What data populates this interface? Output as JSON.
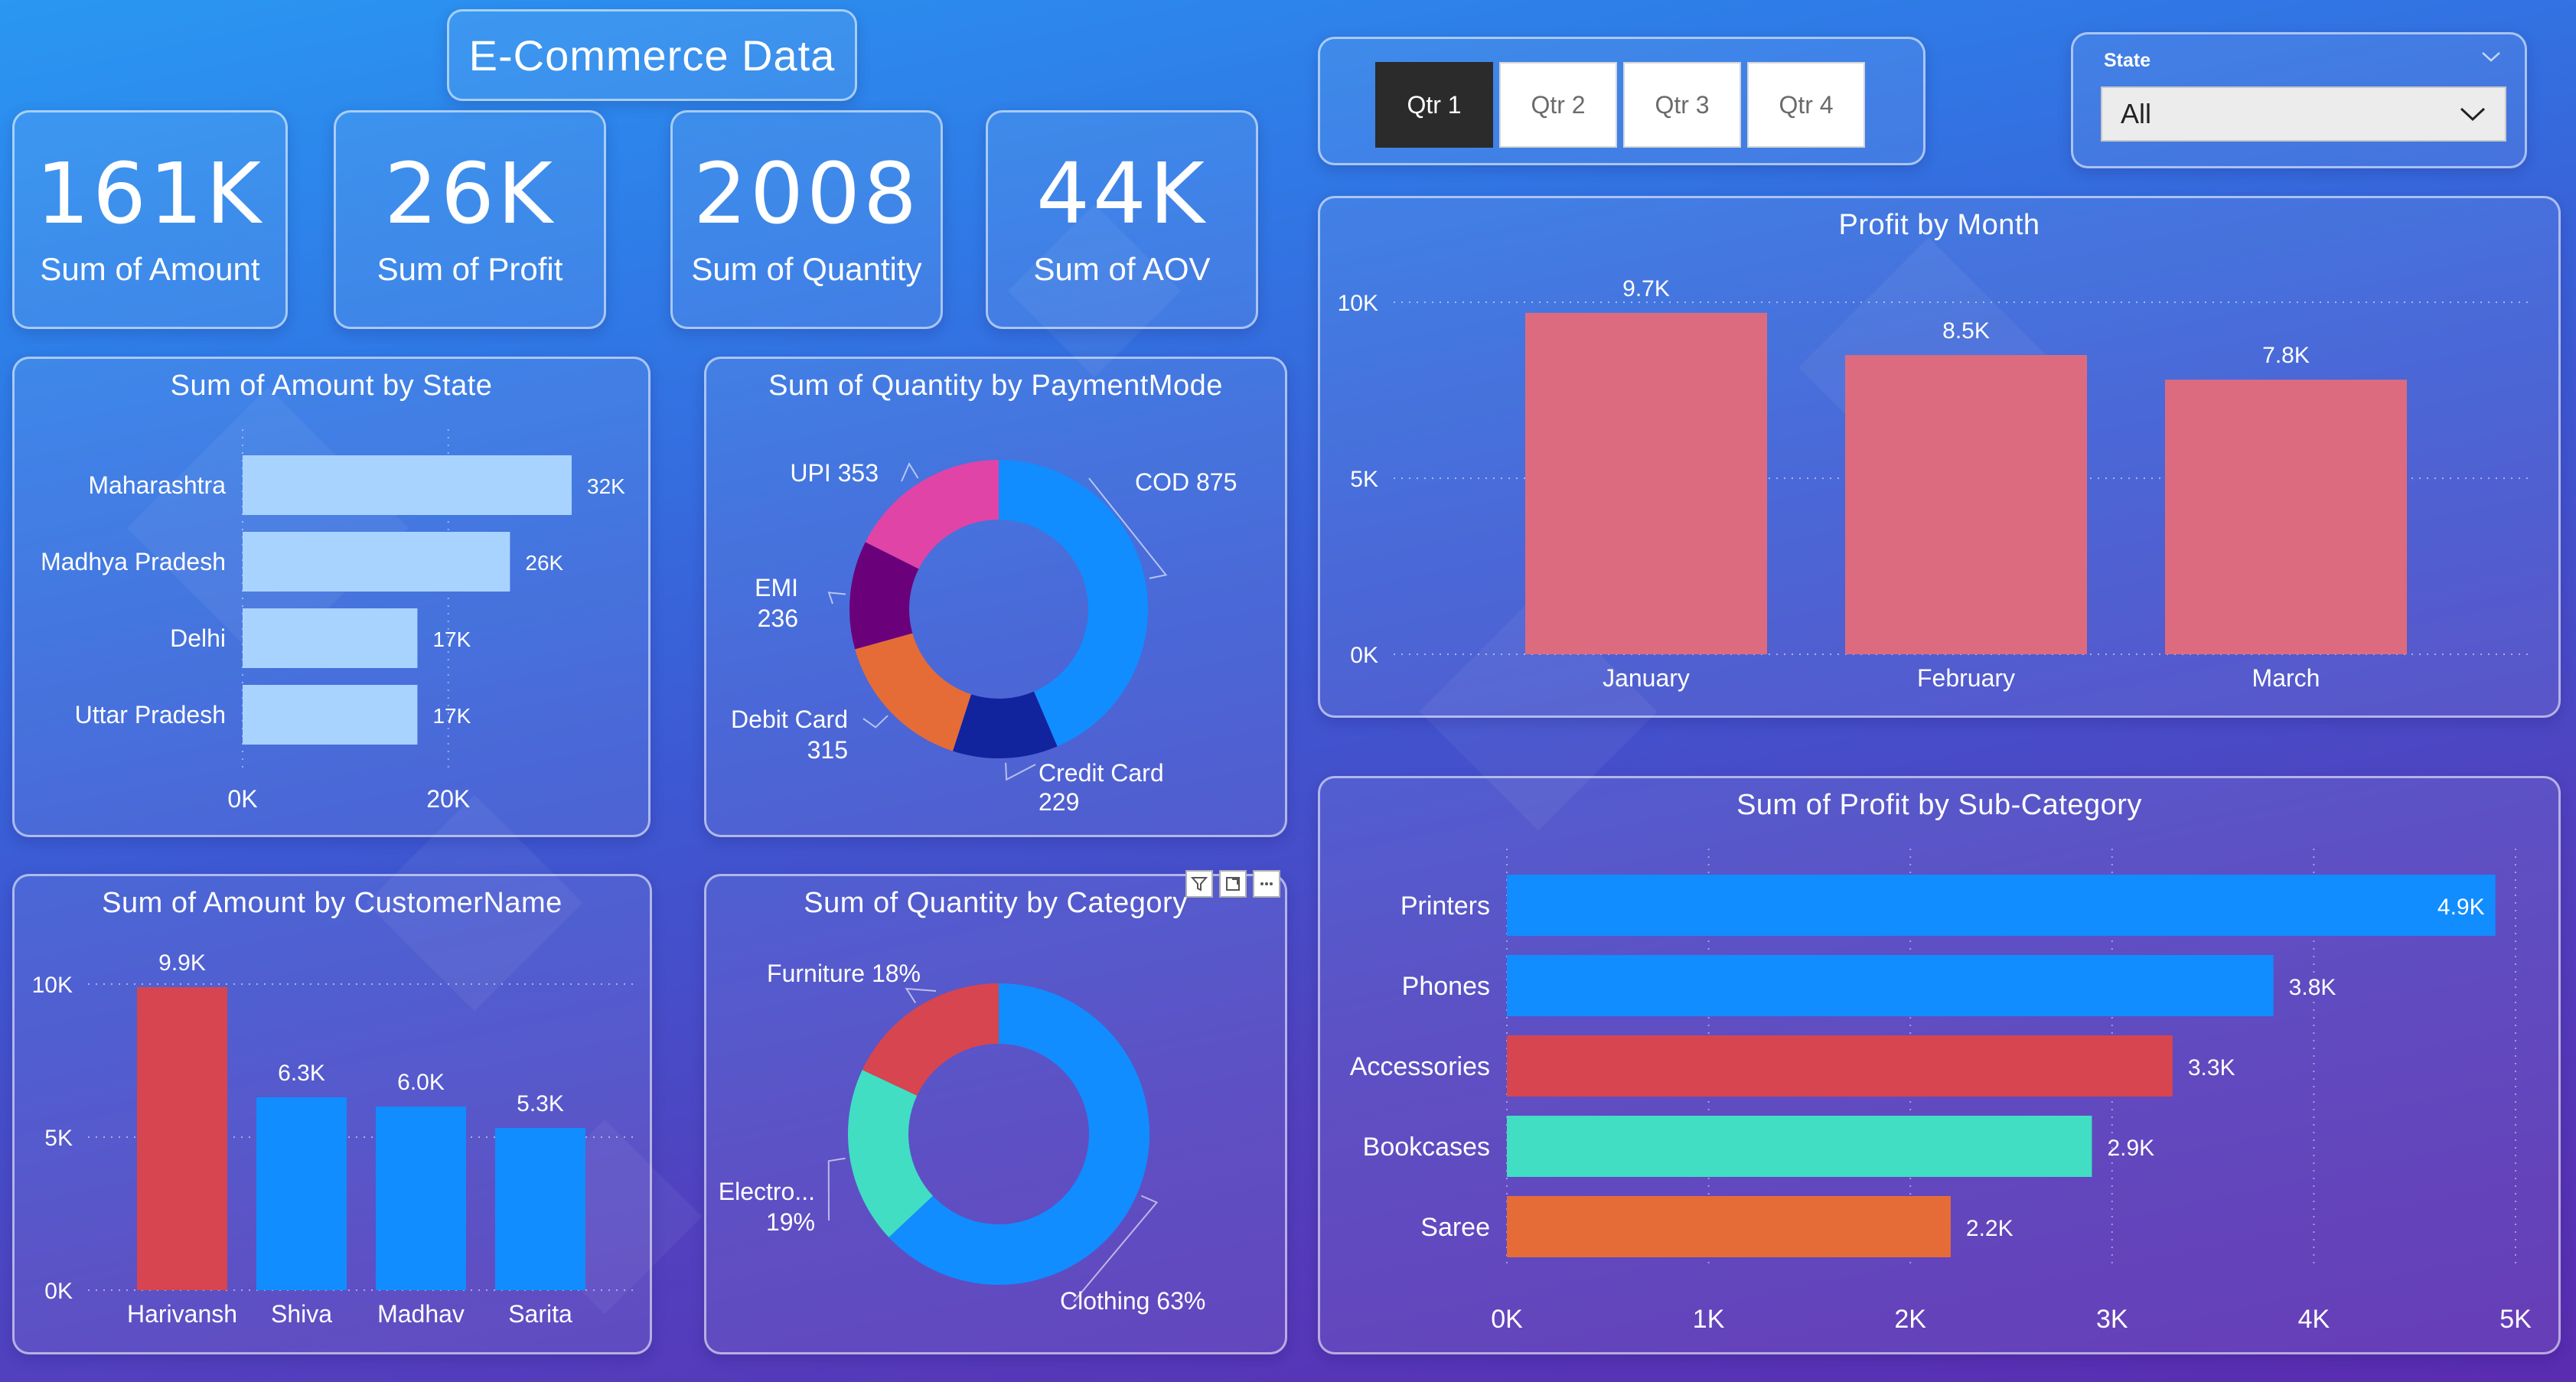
{
  "dashboard_title": "E-Commerce Data",
  "kpis": [
    {
      "value": "161K",
      "label": "Sum of Amount"
    },
    {
      "value": "26K",
      "label": "Sum of Profit"
    },
    {
      "value": "2008",
      "label": "Sum of Quantity"
    },
    {
      "value": "44K",
      "label": "Sum of AOV"
    }
  ],
  "quarter_slicer": {
    "buttons": [
      "Qtr 1",
      "Qtr 2",
      "Qtr 3",
      "Qtr 4"
    ],
    "selected": "Qtr 1"
  },
  "state_slicer": {
    "label": "State",
    "value": "All"
  },
  "colors": {
    "light_bar": "#a9d3ff",
    "blue": "#118dff",
    "salmon": "#dd6b7f",
    "red": "#d64550",
    "teal": "#41dec4",
    "orange": "#e66c37",
    "pink": "#e044a7",
    "purple": "#6b007b",
    "navy": "#12239e",
    "dark_slicer": "#2b2b2b"
  },
  "chart_data": [
    {
      "id": "amount_by_state",
      "type": "bar",
      "orientation": "horizontal",
      "title": "Sum of Amount by State",
      "categories": [
        "Maharashtra",
        "Madhya Pradesh",
        "Delhi",
        "Uttar Pradesh"
      ],
      "values": [
        32000,
        26000,
        17000,
        17000
      ],
      "data_labels": [
        "32K",
        "26K",
        "17K",
        "17K"
      ],
      "xticks": [
        "0K",
        "20K"
      ],
      "xlim": [
        0,
        32000
      ],
      "grid": true
    },
    {
      "id": "quantity_by_paymentmode",
      "type": "pie",
      "donut": true,
      "title": "Sum of Quantity by PaymentMode",
      "categories": [
        "COD",
        "Credit Card",
        "Debit Card",
        "EMI",
        "UPI"
      ],
      "values": [
        875,
        229,
        315,
        236,
        353
      ],
      "colors": [
        "#118dff",
        "#12239e",
        "#e66c37",
        "#6b007b",
        "#e044a7"
      ]
    },
    {
      "id": "profit_by_month",
      "type": "bar",
      "orientation": "vertical",
      "title": "Profit by Month",
      "categories": [
        "January",
        "February",
        "March"
      ],
      "values": [
        9700,
        8500,
        7800
      ],
      "data_labels": [
        "9.7K",
        "8.5K",
        "7.8K"
      ],
      "yticks": [
        "0K",
        "5K",
        "10K"
      ],
      "ylim": [
        0,
        10000
      ],
      "grid": true
    },
    {
      "id": "amount_by_customername",
      "type": "bar",
      "orientation": "vertical",
      "title": "Sum of Amount by CustomerName",
      "categories": [
        "Harivansh",
        "Shiva",
        "Madhav",
        "Sarita"
      ],
      "values": [
        9900,
        6300,
        6000,
        5300
      ],
      "data_labels": [
        "9.9K",
        "6.3K",
        "6.0K",
        "5.3K"
      ],
      "yticks": [
        "0K",
        "5K",
        "10K"
      ],
      "ylim": [
        0,
        10000
      ],
      "grid": true
    },
    {
      "id": "quantity_by_category",
      "type": "pie",
      "donut": true,
      "title": "Sum of Quantity by Category",
      "categories": [
        "Clothing",
        "Electro...",
        "Furniture"
      ],
      "values": [
        63,
        19,
        18
      ],
      "colors": [
        "#118dff",
        "#41dec4",
        "#d64550"
      ]
    },
    {
      "id": "profit_by_subcategory",
      "type": "bar",
      "orientation": "horizontal",
      "title": "Sum of Profit by Sub-Category",
      "categories": [
        "Printers",
        "Phones",
        "Accessories",
        "Bookcases",
        "Saree"
      ],
      "values": [
        4900,
        3800,
        3300,
        2900,
        2200
      ],
      "data_labels": [
        "4.9K",
        "3.8K",
        "3.3K",
        "2.9K",
        "2.2K"
      ],
      "xticks": [
        "0K",
        "1K",
        "2K",
        "3K",
        "4K",
        "5K"
      ],
      "xlim": [
        0,
        5000
      ],
      "grid": true
    }
  ],
  "donut_labels": {
    "payment": [
      {
        "name": "COD",
        "value": "875"
      },
      {
        "name": "Credit Card",
        "value": "229"
      },
      {
        "name": "Debit Card",
        "value": "315"
      },
      {
        "name": "EMI",
        "value": "236"
      },
      {
        "name": "UPI",
        "value": "353"
      }
    ],
    "category": [
      {
        "name": "Clothing",
        "value": "63%"
      },
      {
        "name": "Electro...",
        "value": "19%"
      },
      {
        "name": "Furniture",
        "value": "18%"
      }
    ]
  }
}
